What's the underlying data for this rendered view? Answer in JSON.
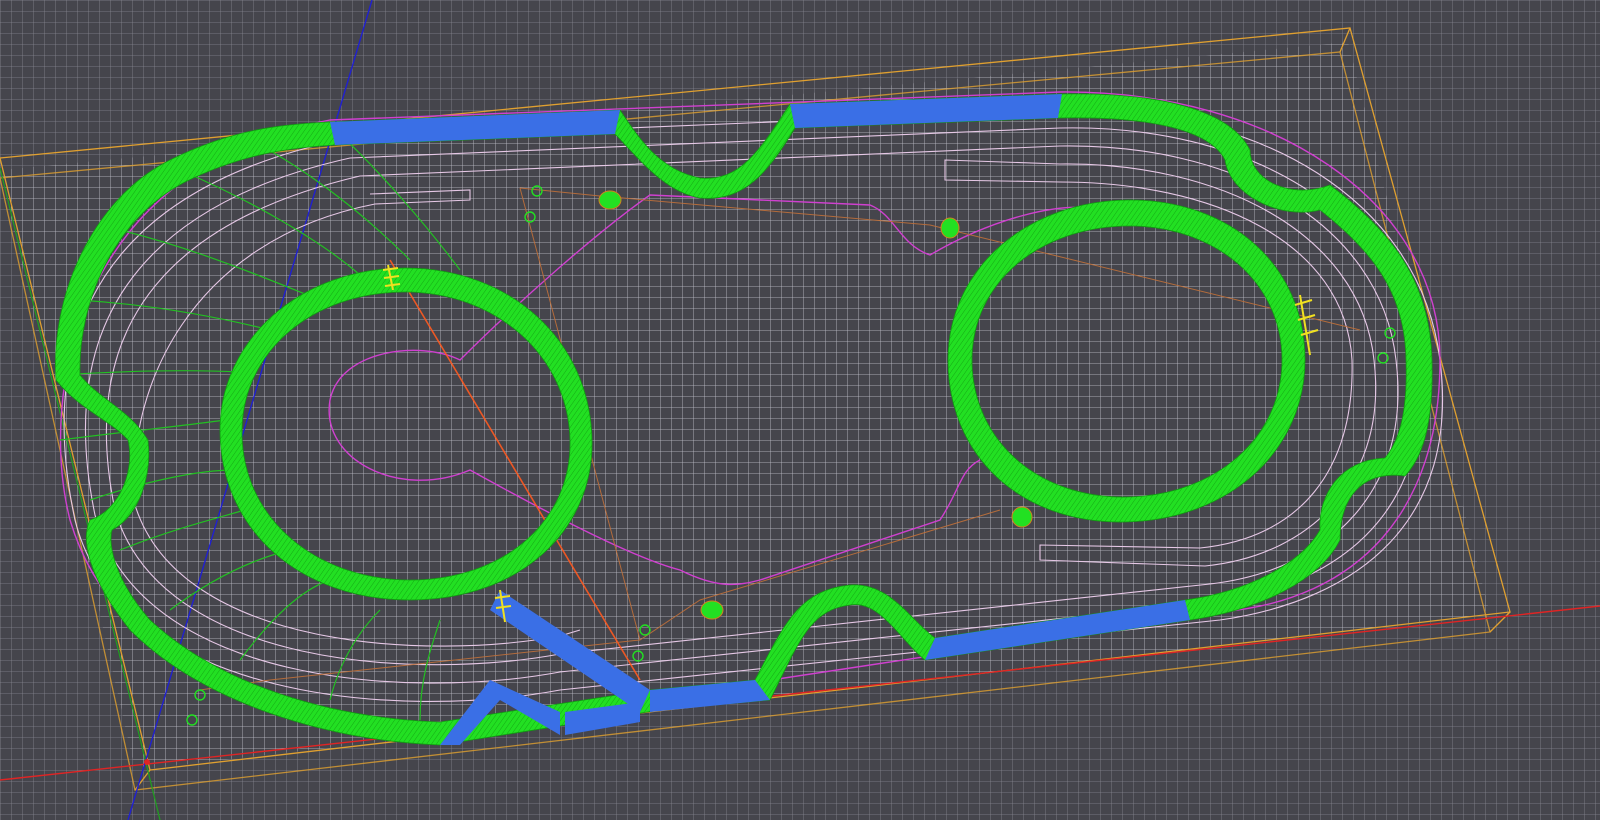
{
  "viewport": {
    "kind": "3d-toolpath-simulation",
    "colors": {
      "background": "#45454c",
      "grid": "#9a9aa6",
      "stock_outline": "#e0a030",
      "x_axis": "#e02424",
      "y_axis": "#1fa01f",
      "z_axis": "#2020d0",
      "cut_region": "#22e022",
      "cut_region_edge": "#119a11",
      "flat_floor": "#3a6fe6",
      "profile_contour": "#d040d0",
      "offset_contours": "#e6c8e6",
      "rapid_moves": "#c0703a",
      "plunge_marker": "#f0e020"
    },
    "icons": {
      "plunge_points": "plunge-marker-icon",
      "retract_points": "retract-circle-icon"
    }
  }
}
